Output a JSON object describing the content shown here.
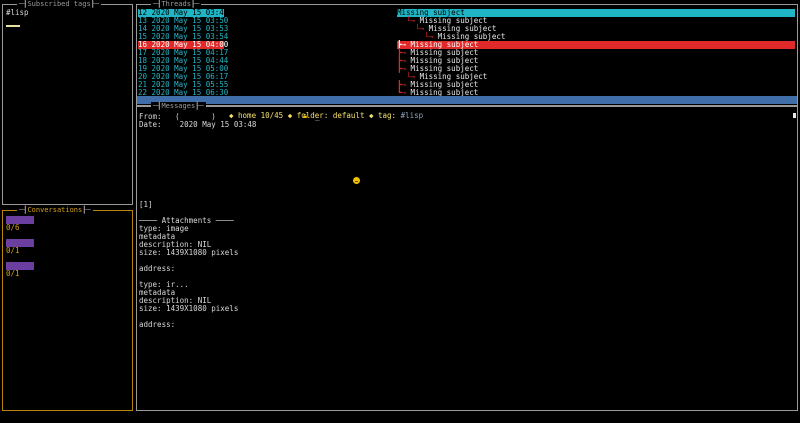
{
  "tags_panel": {
    "title": "Subscribed tags",
    "items": [
      "#lisp"
    ]
  },
  "conversations_panel": {
    "title": "Conversations",
    "items": [
      {
        "count": "0/6"
      },
      {
        "count": "0/1"
      },
      {
        "count": "0/1"
      }
    ],
    "colors": {
      "bar": "#6b3fa0",
      "count": "#d4a017"
    }
  },
  "threads_panel": {
    "title": "Threads",
    "rows": [
      {
        "date": "12 2020 May 15 03:48",
        "subject": "Missing subject",
        "indent": "",
        "arrow": "",
        "state": "selected"
      },
      {
        "date": "13 2020 May 15 03:50",
        "subject": "Missing subject",
        "indent": "  ",
        "arrow": "└→ ",
        "state": ""
      },
      {
        "date": "14 2020 May 15 03:53",
        "subject": "Missing subject",
        "indent": "    ",
        "arrow": "└→ ",
        "state": ""
      },
      {
        "date": "15 2020 May 15 03:54",
        "subject": "Missing subject",
        "indent": "      ",
        "arrow": "└→ ",
        "state": ""
      },
      {
        "date": "16 2020 May 15 04:00",
        "subject": "Missing subject",
        "indent": "",
        "arrow": "┣→ ",
        "state": "error"
      },
      {
        "date": "17 2020 May 15 04:17",
        "subject": "Missing subject",
        "indent": "",
        "arrow": "┣→ ",
        "state": ""
      },
      {
        "date": "18 2020 May 15 04:44",
        "subject": "Missing subject",
        "indent": "",
        "arrow": "┣→ ",
        "state": ""
      },
      {
        "date": "19 2020 May 15 05:00",
        "subject": "Missing subject",
        "indent": "",
        "arrow": "┣→ ",
        "state": ""
      },
      {
        "date": "20 2020 May 15 06:17",
        "subject": "Missing subject",
        "indent": "  ",
        "arrow": "└→ ",
        "state": ""
      },
      {
        "date": "21 2020 May 15 05:55",
        "subject": "Missing subject",
        "indent": "",
        "arrow": "┣→ ",
        "state": ""
      },
      {
        "date": "22 2020 May 15 06:30",
        "subject": "Missing subject",
        "indent": "",
        "arrow": "┗→ ",
        "state": ""
      }
    ],
    "colors": {
      "date": "#1fb5c5",
      "selected_bg": "#1fb5c5",
      "error_bg": "#e02a2a"
    }
  },
  "status_bar": {
    "text": "◆ home 10/45 ◆ folder: default ◆ tag:",
    "tail": " #lisp ",
    "colors": {
      "bg": "#3f6ea8",
      "fg": "#f4e06a"
    }
  },
  "messages_panel": {
    "title": "Messages",
    "from_label": "From:",
    "from_value": "(       )",
    "from_trail": "_",
    "date_label": "Date:",
    "date_value": "2020 May 15 03:48",
    "lock_icon": "lock-icon",
    "emoji_icon": "smiley-icon",
    "footnote": "[1]",
    "attachments_header": "──── Attachments ────",
    "attachments": [
      {
        "type_line": "type: image",
        "metadata": "metadata",
        "description": "description: NIL",
        "size": "size: 1439X1080 pixels",
        "address": "address:"
      },
      {
        "type_line": "type: ir...",
        "metadata": "metadata",
        "description": "description: NIL",
        "size": "size: 1439X1080 pixels",
        "address": "address:"
      }
    ]
  }
}
